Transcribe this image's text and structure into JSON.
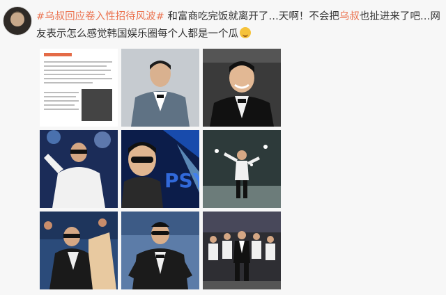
{
  "post": {
    "segments": [
      {
        "type": "hashtag",
        "text": "#乌叔回应卷入性招待风波#"
      },
      {
        "type": "text",
        "text": " 和富商吃完饭就离开了…天啊！不会把"
      },
      {
        "type": "mention",
        "text": "乌叔"
      },
      {
        "type": "text",
        "text": "也扯进来了吧…网友表示怎么感觉韩国娱乐圈每个人都是一个瓜"
      }
    ],
    "emoji": "melon-face-emoji"
  },
  "images": [
    {
      "name": "image-1-article-screenshot",
      "kind": "document"
    },
    {
      "name": "image-2-psy-grey-suit",
      "kind": "photo"
    },
    {
      "name": "image-3-psy-black-tuxedo",
      "kind": "photo"
    },
    {
      "name": "image-4-psy-white-suit-stage",
      "kind": "photo"
    },
    {
      "name": "image-5-psy-sunglasses-stage",
      "kind": "photo"
    },
    {
      "name": "image-6-psy-dancing-stage",
      "kind": "photo"
    },
    {
      "name": "image-7-psy-concert-crowd",
      "kind": "photo"
    },
    {
      "name": "image-8-psy-stadium-performance",
      "kind": "photo"
    },
    {
      "name": "image-9-psy-group-dance",
      "kind": "photo"
    }
  ],
  "colors": {
    "accent": "#eb7350",
    "text": "#333333",
    "background": "#f7f7f7"
  }
}
